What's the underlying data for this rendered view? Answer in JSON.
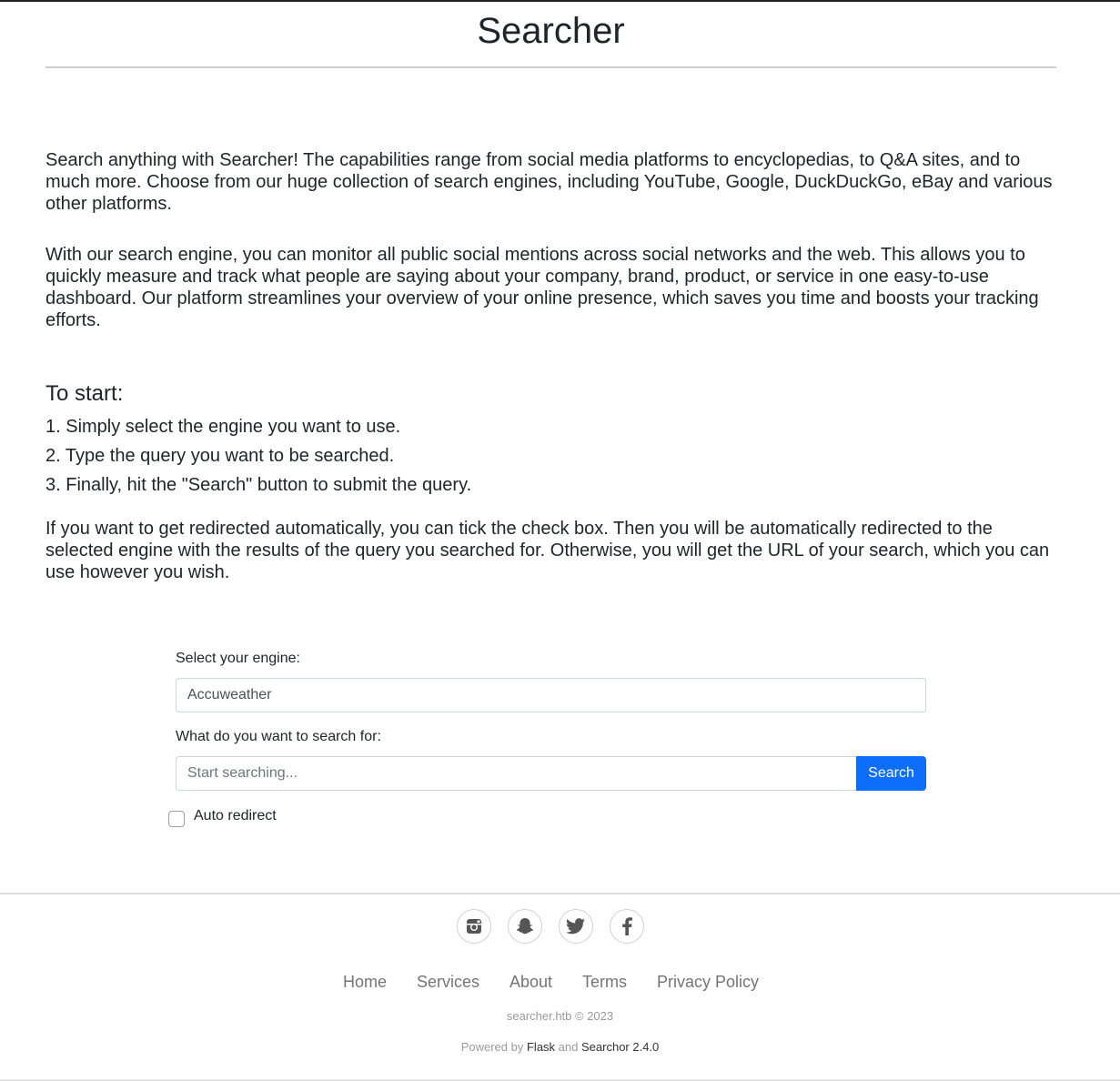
{
  "header": {
    "title": "Searcher"
  },
  "intro": {
    "paragraph1": "Search anything with Searcher! The capabilities range from social media platforms to encyclopedias, to Q&A sites, and to much more. Choose from our huge collection of search engines, including YouTube, Google, DuckDuckGo, eBay and various other platforms.",
    "paragraph2": "With our search engine, you can monitor all public social mentions across social networks and the web. This allows you to quickly measure and track what people are saying about your company, brand, product, or service in one easy-to-use dashboard. Our platform streamlines your overview of your online presence, which saves you time and boosts your tracking efforts."
  },
  "instructions": {
    "heading": "To start:",
    "steps": [
      "1. Simply select the engine you want to use.",
      "2. Type the query you want to be searched.",
      "3. Finally, hit the \"Search\" button to submit the query."
    ],
    "note": "If you want to get redirected automatically, you can tick the check box. Then you will be automatically redirected to the selected engine with the results of the query you searched for. Otherwise, you will get the URL of your search, which you can use however you wish."
  },
  "form": {
    "engine_label": "Select your engine:",
    "engine_value": "Accuweather",
    "query_label": "What do you want to search for:",
    "query_placeholder": "Start searching...",
    "search_button": "Search",
    "auto_redirect_label": "Auto redirect",
    "auto_redirect_checked": false
  },
  "footer": {
    "social_icons": [
      "instagram-icon",
      "snapchat-icon",
      "twitter-icon",
      "facebook-icon"
    ],
    "nav": [
      "Home",
      "Services",
      "About",
      "Terms",
      "Privacy Policy"
    ],
    "copyright": "searcher.htb © 2023",
    "powered_prefix": "Powered by",
    "powered_flask": "Flask",
    "powered_and": "and",
    "powered_searchor": "Searchor 2.4.0"
  },
  "colors": {
    "primary": "#0d6efd",
    "text": "#212529",
    "muted": "#757575"
  }
}
